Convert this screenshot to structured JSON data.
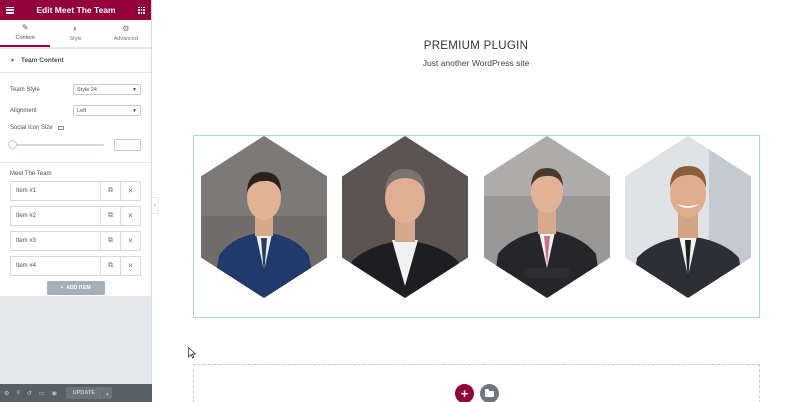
{
  "panel": {
    "title": "Edit Meet The Team",
    "tabs": [
      {
        "label": "Content",
        "icon": "pencil-icon"
      },
      {
        "label": "Style",
        "icon": "half-circle-icon"
      },
      {
        "label": "Advanced",
        "icon": "gear-icon"
      }
    ],
    "section_title": "Team Content",
    "team_style": {
      "label": "Team Style",
      "value": "Style 24"
    },
    "alignment": {
      "label": "Alignment",
      "value": "Left"
    },
    "social_icon_size": {
      "label": "Social Icon Size",
      "value": ""
    },
    "repeater": {
      "label": "Meet The Team",
      "items": [
        {
          "label": "Item #1"
        },
        {
          "label": "Item #2"
        },
        {
          "label": "Item #3"
        },
        {
          "label": "Item #4"
        }
      ],
      "add_label": "ADD ITEM"
    },
    "footer": {
      "update_label": "UPDATE"
    },
    "accent_color": "#93003c"
  },
  "preview": {
    "site_title": "PREMIUM PLUGIN",
    "site_tagline": "Just another WordPress site",
    "team_members": [
      {
        "photo": "man in blue suit, striped tie"
      },
      {
        "photo": "man in dark suit, white open-collar shirt"
      },
      {
        "photo": "man in dark suit, pink tie, arms folded"
      },
      {
        "photo": "smiling man in dark suit and tie"
      }
    ]
  }
}
